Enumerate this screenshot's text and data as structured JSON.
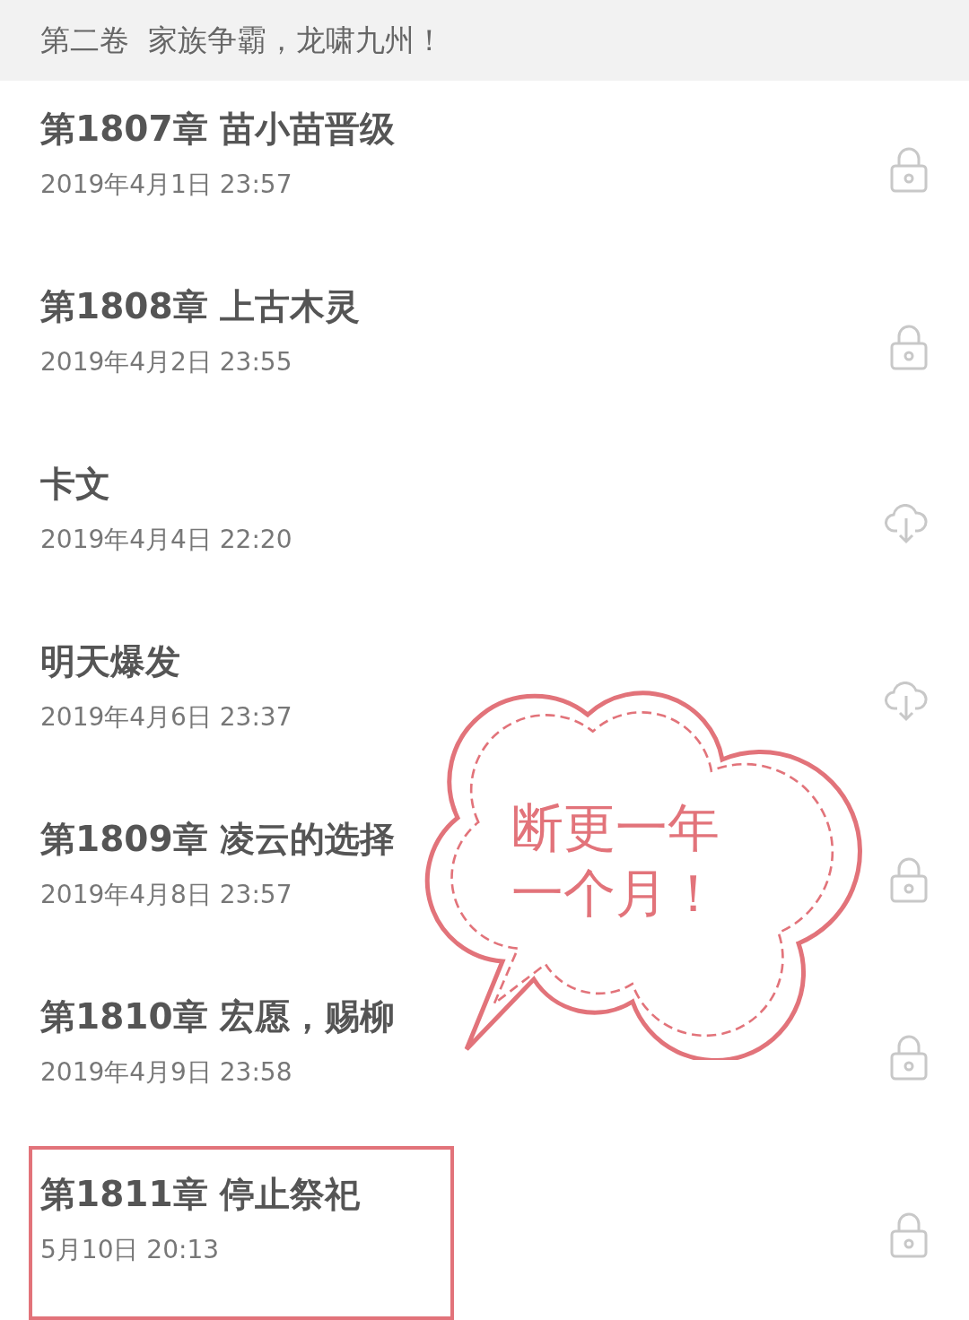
{
  "volume_header": {
    "title": "第二卷  家族争霸，龙啸九州！"
  },
  "chapters": [
    {
      "title": "第1807章 苗小苗晋级",
      "date": "2019年4月1日 23:57",
      "kind": "locked",
      "highlighted": false
    },
    {
      "title": "第1808章 上古木灵",
      "date": "2019年4月2日 23:55",
      "kind": "locked",
      "highlighted": false
    },
    {
      "title": "卡文",
      "date": "2019年4月4日 22:20",
      "kind": "download",
      "highlighted": false
    },
    {
      "title": "明天爆发",
      "date": "2019年4月6日 23:37",
      "kind": "download",
      "highlighted": false
    },
    {
      "title": "第1809章 凌云的选择",
      "date": "2019年4月8日 23:57",
      "kind": "locked",
      "highlighted": false
    },
    {
      "title": "第1810章 宏愿，赐柳",
      "date": "2019年4月9日 23:58",
      "kind": "locked",
      "highlighted": false
    },
    {
      "title": "第1811章 停止祭祀",
      "date": "5月10日 20:13",
      "kind": "locked",
      "highlighted": true
    }
  ],
  "callout": {
    "lines": [
      "断更一年",
      "一个月！"
    ]
  }
}
